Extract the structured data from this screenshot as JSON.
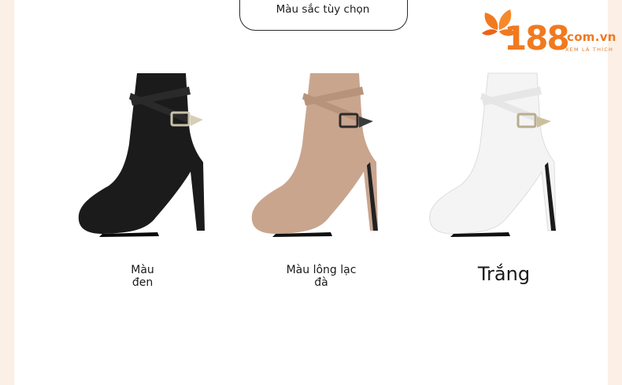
{
  "header": {
    "title": "Màu sắc tùy chọn"
  },
  "logo": {
    "number": "188",
    "domain": ".com.vn",
    "tagline": "XEM LÀ THÍCH"
  },
  "colors": {
    "accent": "#f07a20",
    "background": "#fbefe6"
  },
  "options": [
    {
      "label": "Màu đen",
      "color": "#1b1b1b"
    },
    {
      "label": "Màu lông lạc đà",
      "color": "#c9a58e"
    },
    {
      "label": "Trắng",
      "color": "#f4f4f4"
    }
  ]
}
